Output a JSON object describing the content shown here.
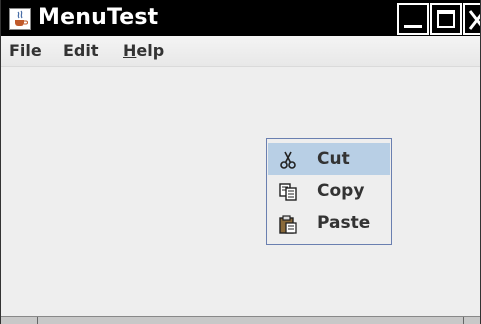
{
  "window": {
    "title": "MenuTest",
    "app_icon": "java-cup-icon",
    "controls": {
      "minimize_icon": "minimize-icon",
      "maximize_icon": "maximize-icon",
      "close_icon": "close-icon"
    }
  },
  "menubar": {
    "items": [
      {
        "label": "File"
      },
      {
        "label": "Edit"
      },
      {
        "label_mnemonic": "H",
        "label_rest": "elp"
      }
    ]
  },
  "popup_menu": {
    "items": [
      {
        "label": "Cut",
        "icon": "scissors-icon",
        "selected": true
      },
      {
        "label": "Copy",
        "icon": "copy-icon",
        "selected": false
      },
      {
        "label": "Paste",
        "icon": "paste-icon",
        "selected": false
      }
    ]
  },
  "colors": {
    "titlebar": "#000000",
    "background": "#eeeeee",
    "selection": "#b8cfe5",
    "popup_border": "#6a7fb0",
    "text": "#333333"
  }
}
